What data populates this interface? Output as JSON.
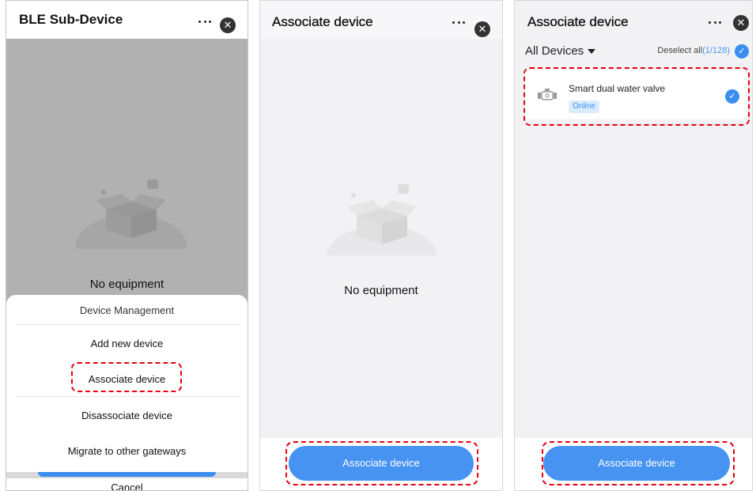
{
  "panel1": {
    "title": "BLE Sub-Device",
    "empty_text": "No equipment",
    "sheet": {
      "header": "Device Management",
      "items": [
        "Add new device",
        "Associate device",
        "Disassociate device",
        "Migrate to other gateways"
      ],
      "cancel": "Cancel"
    }
  },
  "panel2": {
    "title": "Associate device",
    "empty_text": "No equipment",
    "button": "Associate device"
  },
  "panel3": {
    "title": "Associate device",
    "filter": "All Devices",
    "deselect_label": "Deselect all",
    "selection_count": "(1/128)",
    "devices": [
      {
        "name": "Smart dual water valve",
        "status": "Online",
        "selected": true
      }
    ],
    "button": "Associate device"
  },
  "colors": {
    "accent": "#4693f2",
    "highlight": "#e60012",
    "overlay": "#b1b1b1"
  }
}
